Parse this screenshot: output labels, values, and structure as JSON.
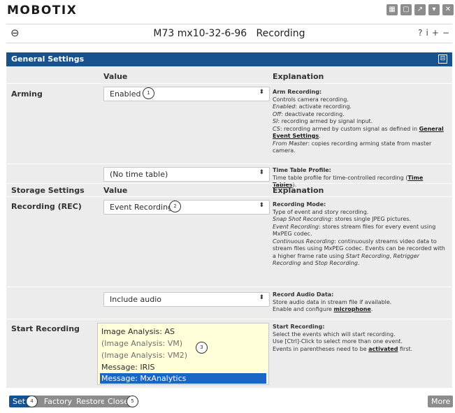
{
  "app": {
    "logo": "MOBOTIX"
  },
  "topbar_icons": [
    "grid-icon",
    "window-icon",
    "external-link-icon",
    "chevron-down-icon",
    "close-icon"
  ],
  "titlebar": {
    "back_icon": "⊖",
    "title": "M73 mx10-32-6-96   Recording",
    "icons": [
      "?",
      "i",
      "+",
      "−"
    ]
  },
  "panel": {
    "title": "General Settings",
    "collapse_icon": "⊟"
  },
  "headers": {
    "value": "Value",
    "explanation": "Explanation"
  },
  "arming": {
    "label": "Arming",
    "value": "Enabled",
    "callout": "1",
    "exp_title": "Arm Recording:",
    "exp_lines": [
      "Controls camera recording."
    ],
    "exp_enabled_term": "Enabled",
    "exp_enabled_text": ": activate recording.",
    "exp_off_term": "Off",
    "exp_off_text": ": deactivate recording.",
    "exp_si_term": "SI",
    "exp_si_text": ": recording armed by signal input.",
    "exp_cs_term": "CS",
    "exp_cs_text": ": recording armed by custom signal as defined in",
    "exp_cs_link": "General Event Settings",
    "exp_cs_end": ".",
    "exp_master_term": "From Master",
    "exp_master_text": ": copies recording arming state from master camera."
  },
  "timetable": {
    "value": "(No time table)",
    "exp_title": "Time Table Profile:",
    "exp_text": "Time table profile for time-controlled recording (",
    "exp_link": "Time Tables",
    "exp_end": ")."
  },
  "storage": {
    "label": "Storage Settings",
    "value_header": "Value",
    "exp_header": "Explanation"
  },
  "recording": {
    "label": "Recording (REC)",
    "value": "Event Recording",
    "callout": "2",
    "exp_title": "Recording Mode:",
    "exp_line1": "Type of event and story recording.",
    "exp_snap_term": "Snap Shot Recording",
    "exp_snap_text": ": stores single JPEG pictures.",
    "exp_event_term": "Event Recording",
    "exp_event_text": ": stores stream files for every event using MxPEG codec.",
    "exp_cont_term": "Continuous Recording",
    "exp_cont_text": ": continuously streams video data to stream files using MxPEG codec. Events can be recorded with a higher frame rate using",
    "exp_start_term": "Start Recording",
    "exp_retrig_term": "Retrigger Recording",
    "exp_and": "and",
    "exp_stop_term": "Stop Recording",
    "exp_stop_end": "."
  },
  "audio": {
    "value": "Include audio",
    "exp_title": "Record Audio Data:",
    "exp_line1": "Store audio data in stream file if available.",
    "exp_line2": "Enable and configure",
    "exp_link": "microphone",
    "exp_end": "."
  },
  "start_recording": {
    "label": "Start Recording",
    "callout": "3",
    "options": [
      "Image Analysis: AS",
      "(Image Analysis: VM)",
      "(Image Analysis: VM2)",
      "Message: IRIS",
      "Message: MxAnalytics"
    ],
    "selected": "Message: MxAnalytics",
    "exp_title": "Start Recording:",
    "exp_line1": "Select the events which will start recording.",
    "exp_line2": "Use [Ctrl]-Click to select more than one event.",
    "exp_line3": "Events in parentheses need to be",
    "exp_link": "activated",
    "exp_line3_end": "first."
  },
  "buttons": {
    "set": "Set",
    "factory": "Factory",
    "restore": "Restore",
    "close": "Close",
    "more": "More",
    "callout_set": "4",
    "callout_close": "5"
  },
  "colors": {
    "header_blue": "#17528e",
    "panel_bg": "#ececec",
    "list_bg": "#fffed9",
    "selected": "#1a66c4",
    "button_gray": "#8c8c8c"
  }
}
